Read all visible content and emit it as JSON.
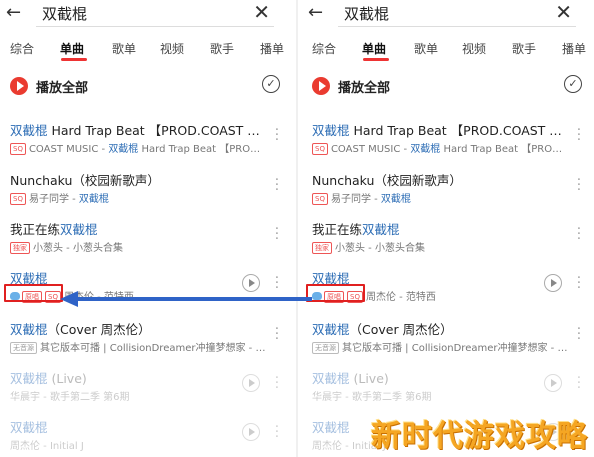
{
  "search": {
    "query": "双截棍"
  },
  "tabs": [
    "综合",
    "单曲",
    "歌单",
    "视频",
    "歌手",
    "播单"
  ],
  "play_all": {
    "label": "播放全部"
  },
  "songs": [
    {
      "title_pre": "",
      "title_hl": "双截棍",
      "title_post": " Hard Trap Beat 【PROD.COAST M…",
      "badges": [
        "SQ"
      ],
      "meta_pre": "COAST MUSIC - ",
      "meta_hl": "双截棍",
      "meta_post": " Hard Trap Beat 【PROD…",
      "dim": false
    },
    {
      "title_pre": "Nunchaku（校园新歌声）",
      "title_hl": "",
      "title_post": "",
      "badges": [
        "SQ"
      ],
      "meta_pre": "易子同学 - ",
      "meta_hl": "双截棍",
      "meta_post": "",
      "dim": false
    },
    {
      "title_pre": "我正在练",
      "title_hl": "双截棍",
      "title_post": "",
      "badges": [
        "独家"
      ],
      "meta_pre": "小葱头 - 小葱头合集",
      "meta_hl": "",
      "meta_post": "",
      "dim": false
    },
    {
      "title_pre": "",
      "title_hl": "双截棍",
      "title_post": "",
      "badges": [
        "cloud",
        "原唱",
        "SQ"
      ],
      "meta_pre": "周杰伦 - 范特西",
      "meta_hl": "",
      "meta_post": "",
      "dim": false
    },
    {
      "title_pre": "",
      "title_hl": "双截棍",
      "title_post": "（Cover 周杰伦）",
      "badges": [
        "无音源"
      ],
      "meta_pre": "其它版本可播 | CollisionDreamer冲撞梦想家 - D…",
      "meta_hl": "",
      "meta_post": "",
      "dim": false
    },
    {
      "title_pre": "",
      "title_hl": "双截棍",
      "title_post": " (Live)",
      "badges": [],
      "meta_pre": "华晨宇 - 歌手第二季 第6期",
      "meta_hl": "",
      "meta_post": "",
      "dim": true
    },
    {
      "title_pre": "",
      "title_hl": "双截棍",
      "title_post": "",
      "badges": [],
      "meta_pre": "周杰伦 - Initial J",
      "meta_hl": "",
      "meta_post": "",
      "dim": true
    }
  ],
  "watermark": "新时代游戏攻略",
  "colors": {
    "accent": "#ea3b30",
    "highlight": "#2d6db5",
    "arrow": "#2f63c7",
    "watermark": "#f5a623"
  }
}
